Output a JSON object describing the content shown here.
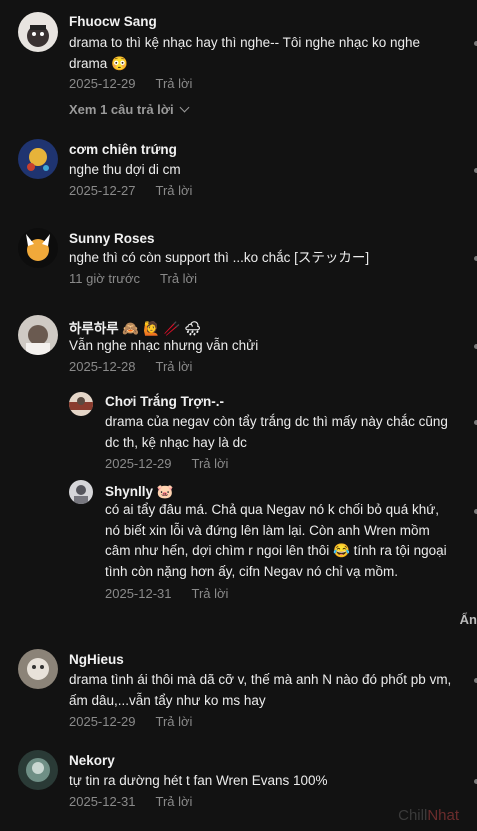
{
  "comments": [
    {
      "user": "Fhuocw Sang",
      "text": "drama to thì kệ nhạc hay thì nghe-- Tôi nghe nhạc ko nghe drama 😳",
      "date": "2025-12-29",
      "reply": "Trả lời"
    },
    {
      "user": "cơm chiên trứng",
      "text": "nghe thu dợi di cm",
      "date": "2025-12-27",
      "reply": "Trả lời"
    },
    {
      "user": "Sunny Roses",
      "text": "nghe thì có còn support thì ...ko chắc [ステッカー]",
      "date": "11 giờ trước",
      "reply": "Trả lời"
    },
    {
      "user": "하루하루 🙈 🙋 🥢 🌧",
      "text": "Vẫn nghe nhạc nhưng vẫn chửi",
      "date": "2025-12-28",
      "reply": "Trả lời"
    },
    {
      "user": "Chơi Trắng Trợn-.-",
      "text": "drama của negav còn tẩy trắng dc thì mấy này chắc cũng dc th, kệ nhạc hay là dc",
      "date": "2025-12-29",
      "reply": "Trả lời"
    },
    {
      "user": "Shynlly 🐷",
      "text": "có ai tẩy đâu má. Chả qua Negav nó k chối bỏ quá khứ, nó biết xin lỗi và đứng lên làm lại. Còn anh Wren mồm câm như hến, dợi chìm r ngoi lên thôi 😂  tính ra tội ngoại tình còn nặng hơn ấy, cifn Negav nó chỉ vạ mồm.",
      "date": "2025-12-31",
      "reply": "Trả lời"
    },
    {
      "user": "NgHieus",
      "text": "drama tình ái thôi mà dã cỡ v, thế mà anh N nào đó phốt pb vm, ấm dâu,...vẫn tẩy như ko ms hay",
      "date": "2025-12-29",
      "reply": "Trả lời"
    },
    {
      "user": "Nekory",
      "text": "tự tin ra dường hét t fan Wren Evans 100%",
      "date": "2025-12-31",
      "reply": "Trả lời"
    }
  ],
  "view_replies": "Xem 1 câu trả lời",
  "hide_label": "Ẩn",
  "watermark": {
    "part1": "Chill",
    "part2": "Nhat"
  }
}
